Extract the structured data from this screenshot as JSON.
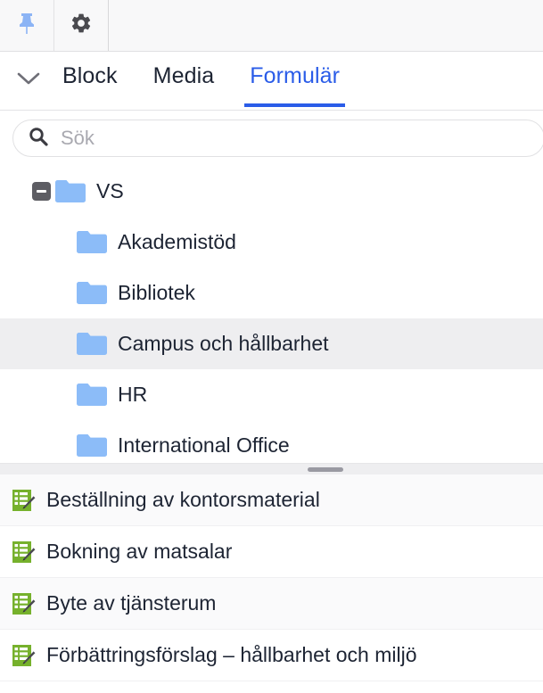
{
  "toolbar": {
    "buttons": [
      {
        "name": "pin-icon",
        "label": "Fäst",
        "color": "#8cb4f5"
      },
      {
        "name": "gear-icon",
        "label": "Inställningar",
        "color": "#4a4a4f"
      }
    ]
  },
  "tabbar": {
    "collapse_icon": "chevron-down-icon",
    "active_color": "#2a5ce8",
    "tabs": [
      {
        "label": "Block",
        "active": false
      },
      {
        "label": "Media",
        "active": false
      },
      {
        "label": "Formulär",
        "active": true
      }
    ]
  },
  "search": {
    "icon": "search-icon",
    "placeholder": "Sök",
    "value": ""
  },
  "tree": {
    "folder_color": "#8cbcf8",
    "root": {
      "label": "VS",
      "expanded": true,
      "toggle_icon": "minus-icon"
    },
    "children": [
      {
        "label": "Akademistöd",
        "selected": false
      },
      {
        "label": "Bibliotek",
        "selected": false
      },
      {
        "label": "Campus och hållbarhet",
        "selected": true
      },
      {
        "label": "HR",
        "selected": false
      },
      {
        "label": "International Office",
        "selected": false
      }
    ]
  },
  "scrollbar": {
    "orientation": "horizontal",
    "thumb_color": "#9a9aa2",
    "track_color": "#eeeef0"
  },
  "forms": {
    "icon": "form-edit-icon",
    "icon_color": "#71b02d",
    "items": [
      {
        "label": "Beställning av kontorsmaterial"
      },
      {
        "label": "Bokning av matsalar"
      },
      {
        "label": "Byte av tjänsterum"
      },
      {
        "label": "Förbättringsförslag – hållbarhet och miljö"
      }
    ]
  }
}
